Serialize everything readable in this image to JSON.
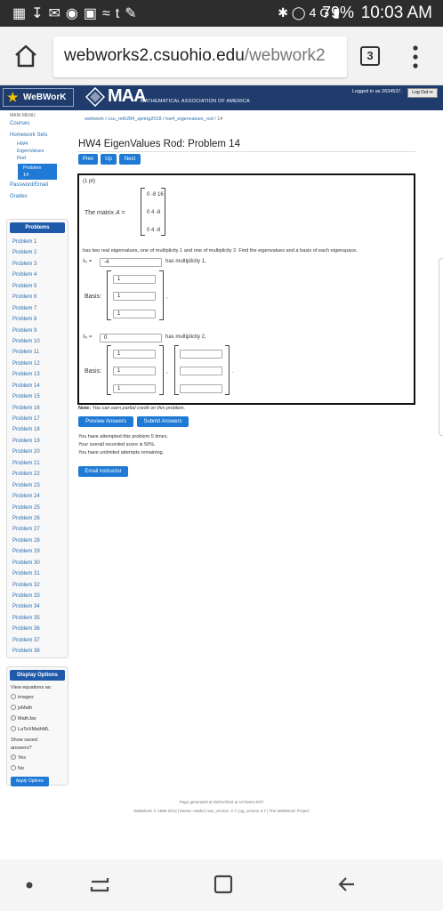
{
  "status_bar": {
    "battery": "79%",
    "time": "10:03 AM",
    "network": "4G"
  },
  "browser": {
    "url_host": "webworks2.csuohio.edu",
    "url_path": "/webwork2",
    "tab_count": "3"
  },
  "header": {
    "logo_text": "WeBWorK",
    "maa_text": "MAA",
    "maa_subtitle": "MATHEMATICAL ASSOCIATION OF AMERICA",
    "logged_in": "Logged in as 2634537.",
    "logout_label": "Log Out"
  },
  "sidebar": {
    "main_menu": "MAIN MENU",
    "courses": "Courses",
    "homework_sets": "Homework Sets",
    "set_line1": "HW4",
    "set_line2": "EigenValues",
    "set_line3": "Rod",
    "current_line1": "Problem",
    "current_line2": "14",
    "password_email": "Password/Email",
    "grades": "Grades",
    "problems_title": "Problems",
    "problems": [
      "Problem 1",
      "Problem 2",
      "Problem 3",
      "Problem 4",
      "Problem 5",
      "Problem 6",
      "Problem 7",
      "Problem 8",
      "Problem 9",
      "Problem 10",
      "Problem 11",
      "Problem 12",
      "Problem 13",
      "Problem 14",
      "Problem 15",
      "Problem 16",
      "Problem 17",
      "Problem 18",
      "Problem 19",
      "Problem 20",
      "Problem 21",
      "Problem 22",
      "Problem 23",
      "Problem 24",
      "Problem 25",
      "Problem 26",
      "Problem 27",
      "Problem 28",
      "Problem 29",
      "Problem 30",
      "Problem 31",
      "Problem 32",
      "Problem 33",
      "Problem 34",
      "Problem 35",
      "Problem 36",
      "Problem 37",
      "Problem 38"
    ],
    "display_options_title": "Display Options",
    "view_equations": "View equations as:",
    "opt_images": "images",
    "opt_jsmath": "jsMath",
    "opt_mathjax": "MathJax",
    "opt_latex": "LaTeXMathML",
    "show_saved": "Show saved",
    "answers": "answers?",
    "opt_yes": "Yes",
    "opt_no": "No",
    "apply_label": "Apply Options"
  },
  "breadcrumb": {
    "c1": "webwork",
    "sep": "/",
    "c2": "csu_mth284_spring2018",
    "c3": "hw4_eigenvalues_rod",
    "c4": "14"
  },
  "problem": {
    "title": "HW4 EigenValues Rod: Problem 14",
    "prev_label": "Prev",
    "up_label": "Up",
    "next_label": "Next",
    "points": "(1 pt)",
    "matrix_label": "The matrix",
    "matrix_var": "A =",
    "matrix_rows": [
      "0 -8 16",
      "0 4 -8",
      "0 4 -8"
    ],
    "statement": "has two real eigenvalues, one of multiplicity 1 and one of multiplicity 2. Find the eigenvalues and a basis of each eigenspace.",
    "lambda1_label": "λ₁ =",
    "lambda1_value": "-4",
    "lambda1_mult": "has multiplicity 1,",
    "basis_label": "Basis:",
    "basis1_values": [
      "1",
      "1",
      "1"
    ],
    "comma": ",",
    "lambda2_label": "λ₂ =",
    "lambda2_value": "0",
    "lambda2_mult": "has multiplicity 2,",
    "basis2a_values": [
      "1",
      "1",
      "1"
    ],
    "basis2b_values": [
      "",
      "",
      ""
    ],
    "period": ".",
    "note_bold": "Note:",
    "note_text": "You can earn partial credit on this problem."
  },
  "actions": {
    "preview_label": "Preview Answers",
    "submit_label": "Submit Answers",
    "attempts": "You have attempted this problem 5 times.",
    "score": "Your overall recorded score is 50%.",
    "remaining": "You have unlimited attempts remaining.",
    "email_label": "Email instructor"
  },
  "footer": {
    "generated": "Page generated at 05/01/2018 at 10:02am EDT",
    "copyright": "WeBWorK © 1996-2013 | theme: math4 | ww_version: 2.7 | pg_version 2.7 | The WeBWorK Project"
  },
  "colors": {
    "header_bg": "#1f3c6d",
    "accent": "#1e7ad4",
    "link": "#2a6fb0"
  }
}
